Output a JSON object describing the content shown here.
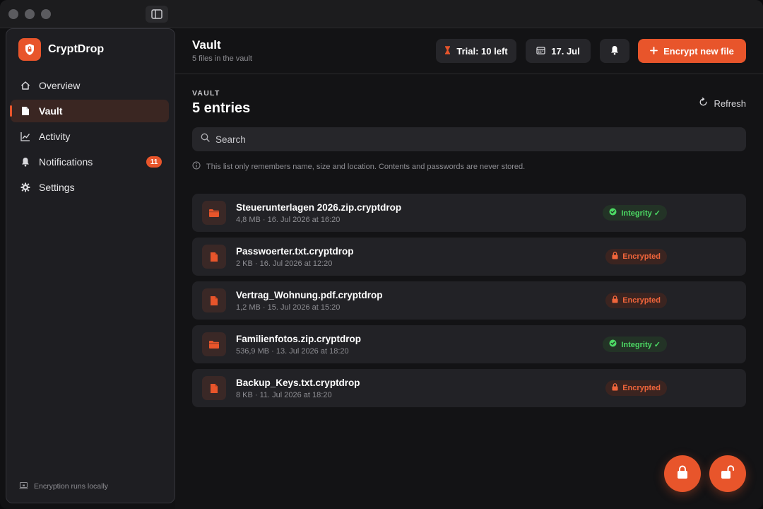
{
  "brand": {
    "name": "CryptDrop"
  },
  "sidebar": {
    "items": [
      {
        "label": "Overview",
        "icon": "home-icon"
      },
      {
        "label": "Vault",
        "icon": "document-icon",
        "active": true
      },
      {
        "label": "Activity",
        "icon": "chart-icon"
      },
      {
        "label": "Notifications",
        "icon": "bell-icon",
        "badge": "11"
      },
      {
        "label": "Settings",
        "icon": "gear-icon"
      }
    ],
    "footer": "Encryption runs locally"
  },
  "header": {
    "title": "Vault",
    "subtitle": "5 files in the vault",
    "trial_label": "Trial: 10 left",
    "date_label": "17. Jul",
    "primary_label": "Encrypt new file"
  },
  "main": {
    "section_label": "VAULT",
    "section_title": "5 entries",
    "refresh_label": "Refresh",
    "search_placeholder": "Search",
    "info_text": "This list only remembers name, size and location. Contents and passwords are never stored."
  },
  "files": [
    {
      "name": "Steuerunterlagen 2026.zip.cryptdrop",
      "meta": "4,8 MB · 16. Jul 2026 at 16:20",
      "type": "folder",
      "status": "Integrity ✓",
      "status_kind": "ok"
    },
    {
      "name": "Passwoerter.txt.cryptdrop",
      "meta": "2 KB · 16. Jul 2026 at 12:20",
      "type": "document",
      "status": "Encrypted",
      "status_kind": "enc"
    },
    {
      "name": "Vertrag_Wohnung.pdf.cryptdrop",
      "meta": "1,2 MB · 15. Jul 2026 at 15:20",
      "type": "document",
      "status": "Encrypted",
      "status_kind": "enc"
    },
    {
      "name": "Familienfotos.zip.cryptdrop",
      "meta": "536,9 MB · 13. Jul 2026 at 18:20",
      "type": "folder",
      "status": "Integrity ✓",
      "status_kind": "ok"
    },
    {
      "name": "Backup_Keys.txt.cryptdrop",
      "meta": "8 KB · 11. Jul 2026 at 18:20",
      "type": "document",
      "status": "Encrypted",
      "status_kind": "enc"
    }
  ],
  "colors": {
    "accent": "#e8552b",
    "ok": "#4cd964",
    "enc": "#f0653b",
    "sidebar_bg": "#1e1e22",
    "main_bg": "#131315"
  }
}
